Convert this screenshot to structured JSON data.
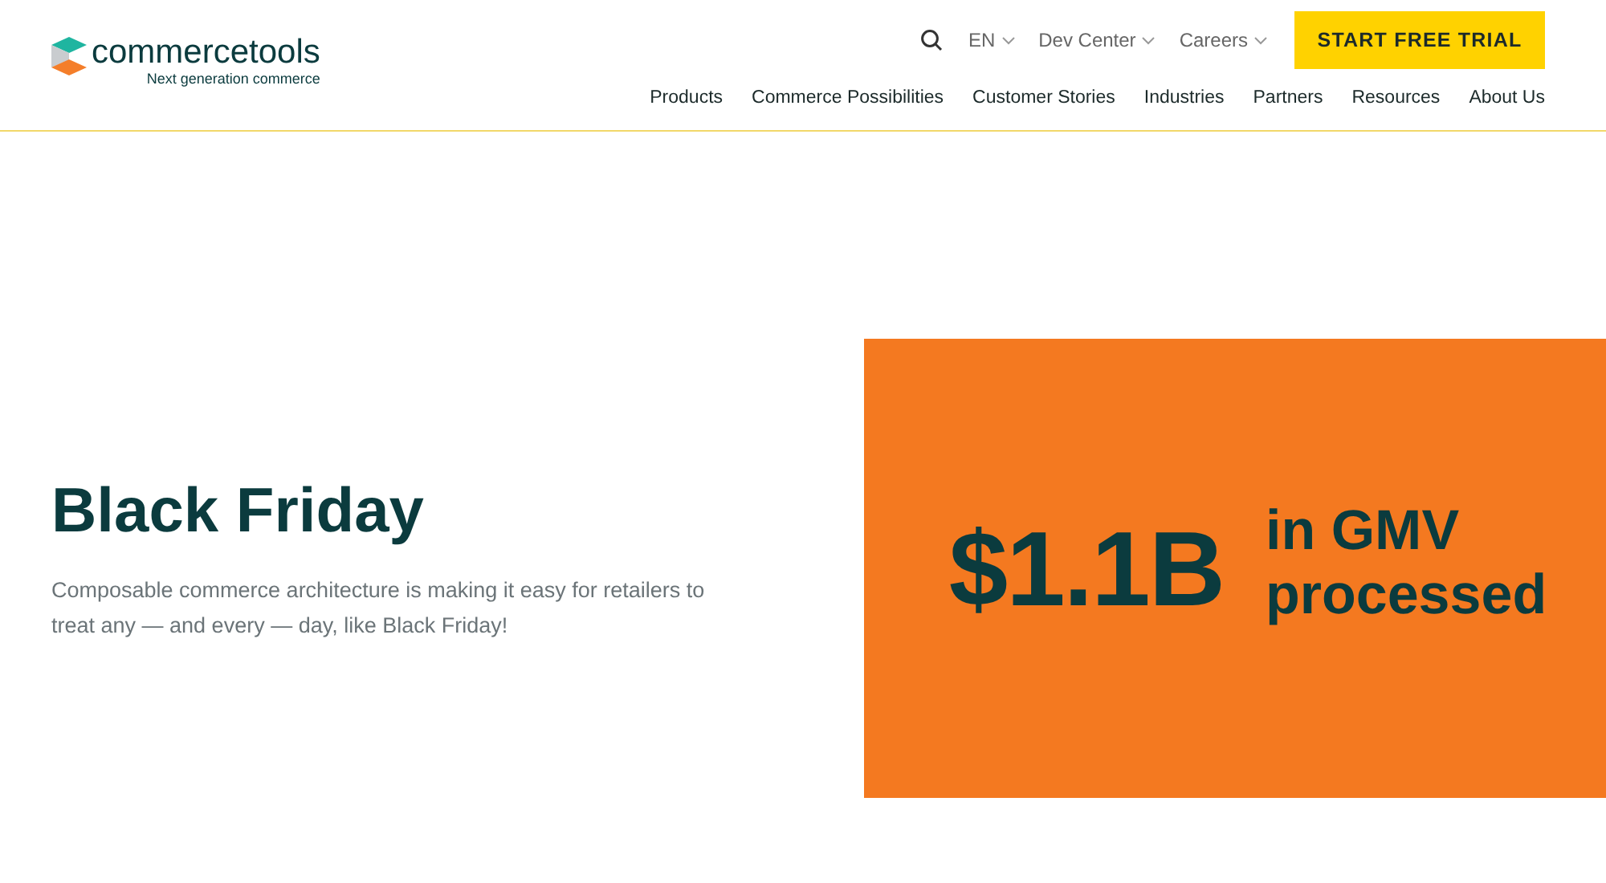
{
  "logo": {
    "name": "commercetools",
    "tagline": "Next generation commerce"
  },
  "top_links": [
    {
      "label": "EN",
      "dropdown": true
    },
    {
      "label": "Dev Center",
      "dropdown": true
    },
    {
      "label": "Careers",
      "dropdown": true
    }
  ],
  "cta_button": "START FREE TRIAL",
  "nav": [
    "Products",
    "Commerce Possibilities",
    "Customer Stories",
    "Industries",
    "Partners",
    "Resources",
    "About Us"
  ],
  "hero": {
    "title": "Black Friday",
    "text": "Composable commerce architecture is making it easy for retailers to treat any — and every — day, like Black Friday!"
  },
  "stat": {
    "value": "$1.1B",
    "label": "in GMV processed"
  }
}
